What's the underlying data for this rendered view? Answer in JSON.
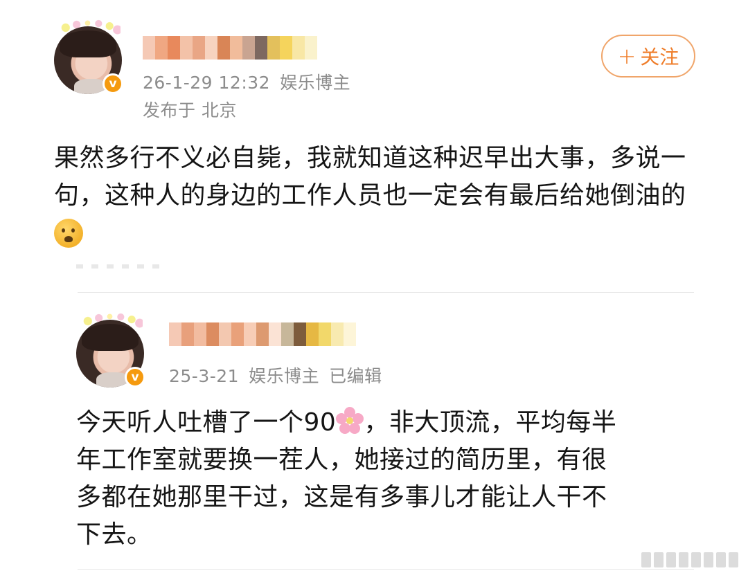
{
  "post1": {
    "timestamp": "26-1-29 12:32",
    "user_tag": "娱乐博主",
    "location": "发布于 北京",
    "follow_label": "关注",
    "follow_plus": "+",
    "verify_mark": "v",
    "text_line1": "果然多行不义必自毙，我就知道这种迟早出大事，多说一",
    "text_line2": "句，这种人的身边的工作人员也一定会有最后给她倒油的"
  },
  "post2": {
    "timestamp": "25-3-21",
    "user_tag": "娱乐博主",
    "edited": "已编辑",
    "verify_mark": "v",
    "text_line1_a": "今天听人吐槽了一个90",
    "text_line1_b": "，非大顶流，平均每半",
    "text_line2": "年工作室就要换一茬人，她接过的简历里，有很",
    "text_line3": "多都在她那里干过，这是有多事儿才能让人干不",
    "text_line4": "下去。"
  },
  "icons": {
    "emoji": "frowning-face-icon",
    "flower": "cherry-blossom-icon",
    "verified": "verified-badge-icon"
  },
  "colors": {
    "accent": "#ef7d2a",
    "verified": "#f59a0f",
    "meta_text": "#8c8c8c"
  }
}
